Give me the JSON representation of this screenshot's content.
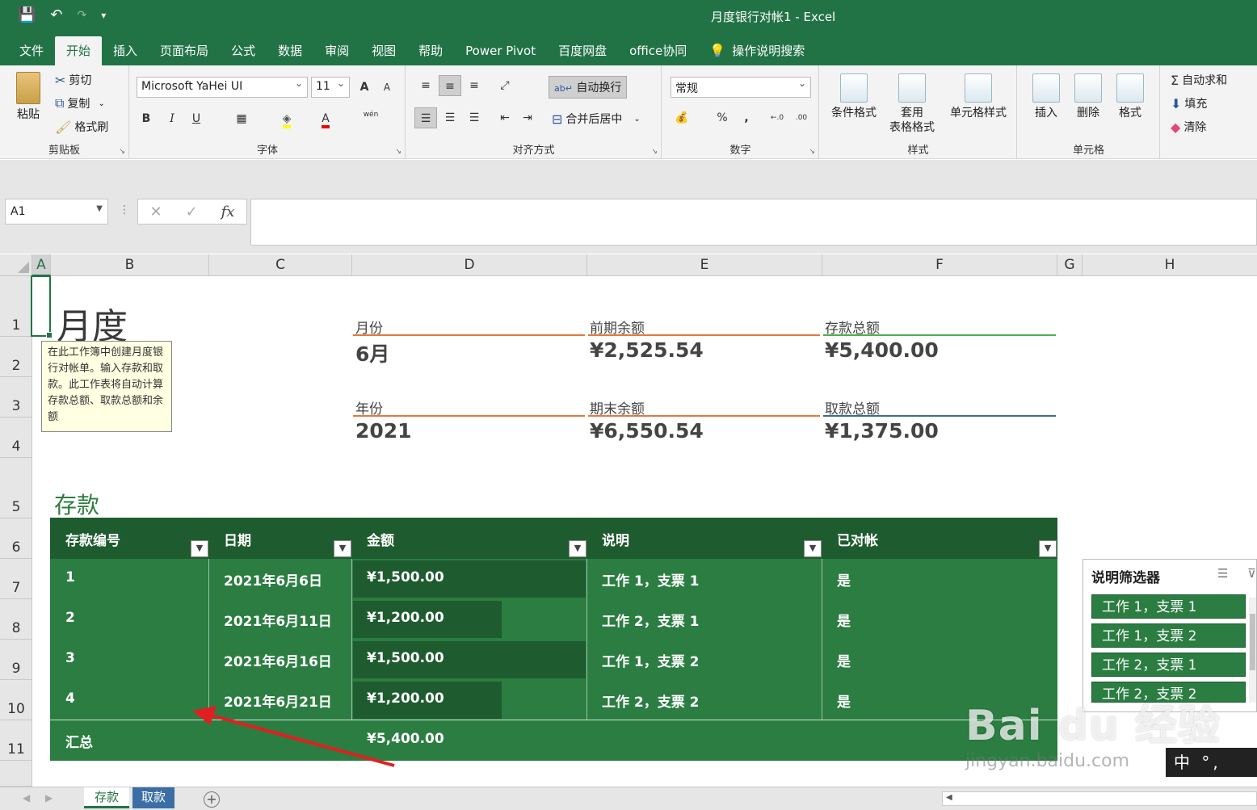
{
  "window": {
    "title": "月度银行对帐1  -  Excel"
  },
  "qat": {
    "save": "💾",
    "undo": "↶",
    "redo": "↷",
    "more": "▾"
  },
  "tabs": [
    "文件",
    "开始",
    "插入",
    "页面布局",
    "公式",
    "数据",
    "审阅",
    "视图",
    "帮助",
    "Power Pivot",
    "百度网盘",
    "office协同"
  ],
  "tell_me": "操作说明搜索",
  "ribbon": {
    "clipboard": {
      "paste": "粘贴",
      "cut": "剪切",
      "copy": "复制",
      "format_painter": "格式刷",
      "label": "剪贴板"
    },
    "font": {
      "name": "Microsoft YaHei UI",
      "size": "11",
      "bold": "B",
      "italic": "I",
      "underline": "U",
      "grow": "A",
      "shrink": "A",
      "color_a": "A",
      "phonetic": "wén",
      "label": "字体"
    },
    "alignment": {
      "wrap": "自动换行",
      "merge": "合并后居中",
      "label": "对齐方式"
    },
    "number": {
      "format": "常规",
      "percent": "%",
      "comma": ",",
      "inc": "←.0",
      "dec": ".00",
      "label": "数字"
    },
    "styles": {
      "conditional": "条件格式",
      "table_l1": "套用",
      "table_l2": "表格格式",
      "cell_styles": "单元格样式",
      "label": "样式"
    },
    "cells": {
      "insert": "插入",
      "delete": "删除",
      "format": "格式",
      "label": "单元格"
    },
    "editing": {
      "autosum": "自动求和",
      "fill": "填充",
      "clear": "清除"
    }
  },
  "formula_bar": {
    "name_box": "A1",
    "cancel": "✕",
    "enter": "✓",
    "fx": "fx",
    "value": ""
  },
  "columns": [
    "A",
    "B",
    "C",
    "D",
    "E",
    "F",
    "G",
    "H"
  ],
  "rows": [
    "1",
    "2",
    "3",
    "4",
    "5",
    "6",
    "7",
    "8",
    "9",
    "10",
    "11"
  ],
  "sheet": {
    "title": "月度",
    "note": "在此工作簿中创建月度银行对帐单。输入存款和取款。此工作表将自动计算存款总额、取款总额和余额",
    "kpis": [
      {
        "label": "月份",
        "value": "6月",
        "color": "#e07b39"
      },
      {
        "label": "前期余额",
        "value": "¥2,525.54",
        "color": "#e07b39"
      },
      {
        "label": "存款总额",
        "value": "¥5,400.00",
        "color": "#4caf50"
      },
      {
        "label": "年份",
        "value": "2021",
        "color": "#e07b39"
      },
      {
        "label": "期末余额",
        "value": "¥6,550.54",
        "color": "#e07b39"
      },
      {
        "label": "取款总额",
        "value": "¥1,375.00",
        "color": "#3a6d8c"
      }
    ],
    "section": "存款",
    "table": {
      "headers": [
        "存款编号",
        "日期",
        "金额",
        "说明",
        "已对帐"
      ],
      "rows": [
        [
          "1",
          "2021年6月6日",
          "¥1,500.00",
          "工作 1，支票 1",
          "是"
        ],
        [
          "2",
          "2021年6月11日",
          "¥1,200.00",
          "工作 2，支票 1",
          "是"
        ],
        [
          "3",
          "2021年6月16日",
          "¥1,500.00",
          "工作 1，支票 2",
          "是"
        ],
        [
          "4",
          "2021年6月21日",
          "¥1,200.00",
          "工作 2，支票 2",
          "是"
        ]
      ],
      "amounts": [
        1500,
        1200,
        1500,
        1200
      ],
      "total_label": "汇总",
      "total_value": "¥5,400.00"
    },
    "slicer": {
      "title": "说明筛选器",
      "items": [
        "工作 1，支票 1",
        "工作 1，支票 2",
        "工作 2，支票 1",
        "工作 2，支票 2"
      ]
    }
  },
  "sheet_tabs": [
    "存款",
    "取款"
  ],
  "watermark": {
    "brand": "Bai du 经验",
    "url": "jingyan.baidu.com"
  },
  "ime": "中 °,"
}
